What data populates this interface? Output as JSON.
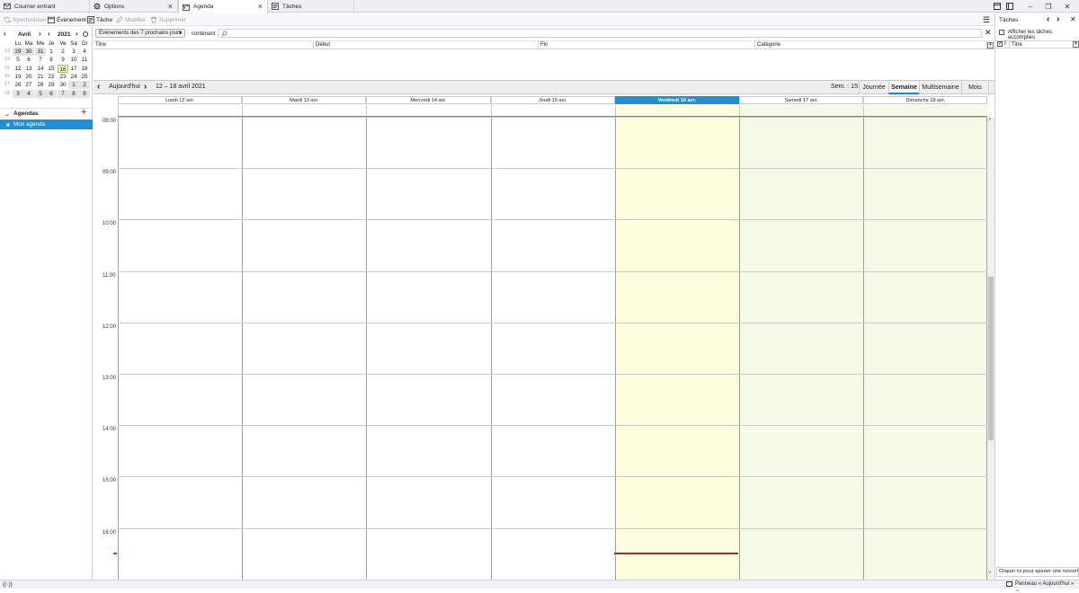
{
  "tabs": [
    {
      "label": "Courrier entrant",
      "icon": "mail-icon"
    },
    {
      "label": "Options",
      "icon": "gear-icon"
    },
    {
      "label": "Agenda",
      "icon": "calendar-icon"
    },
    {
      "label": "Tâches",
      "icon": "tasks-icon"
    }
  ],
  "toolbar": {
    "sync": "Synchroniser",
    "event": "Évènement",
    "task": "Tâche",
    "edit": "Modifier",
    "delete": "Supprimer"
  },
  "search": {
    "filter": "Évènements des 7 prochains jours",
    "contains": "contenant",
    "placeholder": ""
  },
  "list_columns": [
    "Titre",
    "Début",
    "Fin",
    "Catégorie"
  ],
  "minicalendar": {
    "month": "Avril",
    "year": "2021",
    "weekdays": [
      "Lu",
      "Ma",
      "Me",
      "Je",
      "Ve",
      "Sa",
      "Di"
    ],
    "weeks": [
      {
        "num": "13",
        "days": [
          "29",
          "30",
          "31",
          "1",
          "2",
          "3",
          "4"
        ]
      },
      {
        "num": "14",
        "days": [
          "5",
          "6",
          "7",
          "8",
          "9",
          "10",
          "11"
        ]
      },
      {
        "num": "15",
        "days": [
          "12",
          "13",
          "14",
          "15",
          "16",
          "17",
          "18"
        ]
      },
      {
        "num": "16",
        "days": [
          "19",
          "20",
          "21",
          "22",
          "23",
          "24",
          "25"
        ]
      },
      {
        "num": "17",
        "days": [
          "26",
          "27",
          "28",
          "29",
          "30",
          "1",
          "2"
        ]
      },
      {
        "num": "18",
        "days": [
          "3",
          "4",
          "5",
          "6",
          "7",
          "8",
          "9"
        ]
      }
    ],
    "today": "16"
  },
  "agendas": {
    "header": "Agendas",
    "items": [
      "Mon agenda"
    ]
  },
  "nav": {
    "today": "Aujourd'hui",
    "range": "12 – 18 avril 2021",
    "week": "Sem. : 15",
    "views": [
      "Journée",
      "Semaine",
      "Multisemaine",
      "Mois"
    ],
    "selected_view": "Semaine"
  },
  "days": [
    "Lundi 12 avr.",
    "Mardi 13 avr.",
    "Mercredi 14 avr.",
    "Jeudi 15 avr.",
    "Vendredi 16 avr.",
    "Samedi 17 avr.",
    "Dimanche 18 avr."
  ],
  "hours": [
    "08:00",
    "09:00",
    "10:00",
    "11:00",
    "12:00",
    "13:00",
    "14:00",
    "15:00",
    "16:00"
  ],
  "tasks": {
    "title": "Tâches",
    "show_completed": "Afficher les tâches accomplies",
    "col_title": "Titre",
    "add_placeholder": "Cliquer ici pour ajouter une nouvell"
  },
  "status": {
    "panel": "Panneau « Aujourd'hui »"
  },
  "colors": {
    "accent": "#1f8fd6",
    "today_col": "#fdfdde",
    "weekend_col": "#f4fbe6",
    "now_line": "#c0392b"
  }
}
